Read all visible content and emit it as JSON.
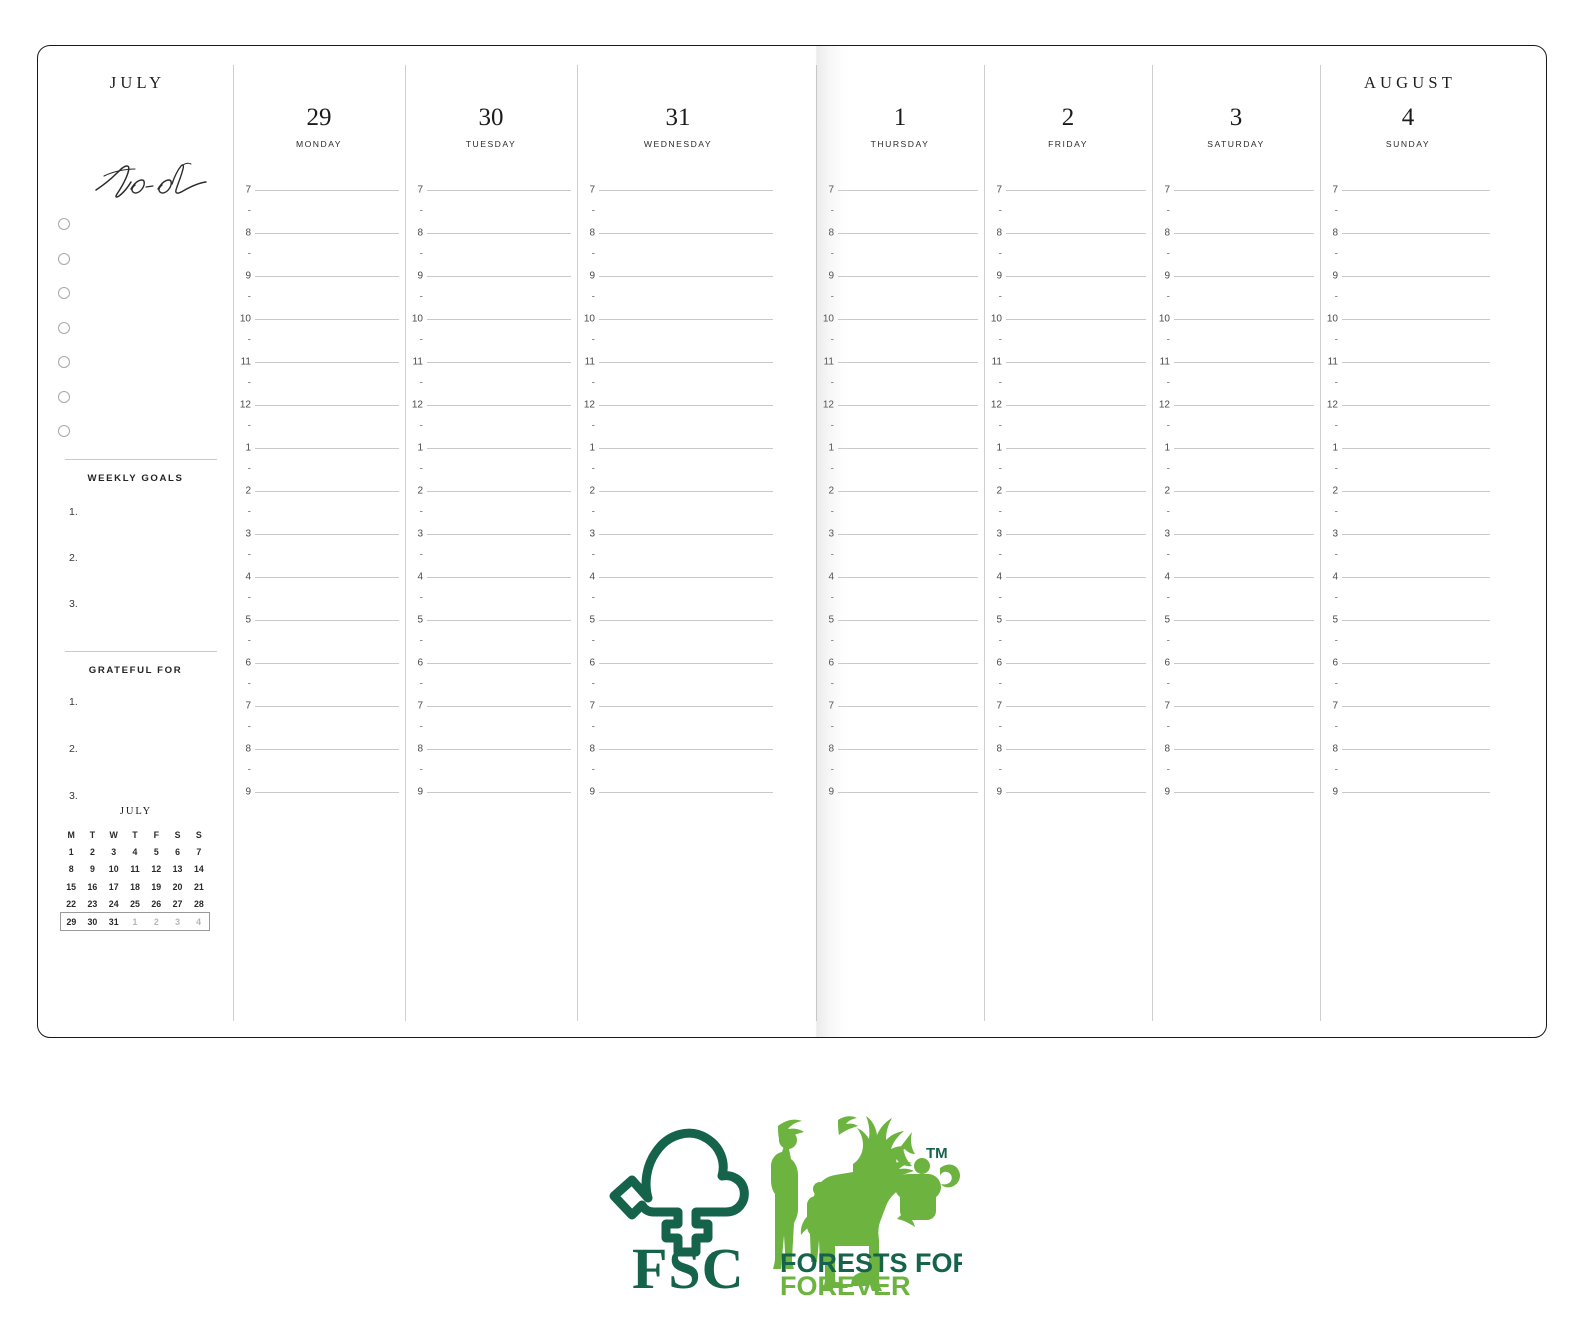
{
  "spread": {
    "left_page": {
      "month": "JULY",
      "todo": {
        "script_label": "To-do",
        "checkbox_count": 7
      },
      "weekly_goals": {
        "title": "WEEKLY GOALS",
        "items": [
          "1.",
          "2.",
          "3."
        ]
      },
      "grateful_for": {
        "title": "GRATEFUL FOR",
        "items": [
          "1.",
          "2.",
          "3."
        ]
      },
      "mini_calendar": {
        "title": "JULY",
        "weekday_headers": [
          "M",
          "T",
          "W",
          "T",
          "F",
          "S",
          "S"
        ],
        "weeks": [
          [
            {
              "d": "1",
              "dim": false
            },
            {
              "d": "2",
              "dim": false
            },
            {
              "d": "3",
              "dim": false
            },
            {
              "d": "4",
              "dim": false
            },
            {
              "d": "5",
              "dim": false
            },
            {
              "d": "6",
              "dim": false
            },
            {
              "d": "7",
              "dim": false
            }
          ],
          [
            {
              "d": "8",
              "dim": false
            },
            {
              "d": "9",
              "dim": false
            },
            {
              "d": "10",
              "dim": false
            },
            {
              "d": "11",
              "dim": false
            },
            {
              "d": "12",
              "dim": false
            },
            {
              "d": "13",
              "dim": false
            },
            {
              "d": "14",
              "dim": false
            }
          ],
          [
            {
              "d": "15",
              "dim": false
            },
            {
              "d": "16",
              "dim": false
            },
            {
              "d": "17",
              "dim": false
            },
            {
              "d": "18",
              "dim": false
            },
            {
              "d": "19",
              "dim": false
            },
            {
              "d": "20",
              "dim": false
            },
            {
              "d": "21",
              "dim": false
            }
          ],
          [
            {
              "d": "22",
              "dim": false
            },
            {
              "d": "23",
              "dim": false
            },
            {
              "d": "24",
              "dim": false
            },
            {
              "d": "25",
              "dim": false
            },
            {
              "d": "26",
              "dim": false
            },
            {
              "d": "27",
              "dim": false
            },
            {
              "d": "28",
              "dim": false
            }
          ],
          [
            {
              "d": "29",
              "dim": false
            },
            {
              "d": "30",
              "dim": false
            },
            {
              "d": "31",
              "dim": false
            },
            {
              "d": "1",
              "dim": true
            },
            {
              "d": "2",
              "dim": true
            },
            {
              "d": "3",
              "dim": true
            },
            {
              "d": "4",
              "dim": true
            }
          ]
        ],
        "highlighted_week_index": 4
      }
    },
    "right_page": {
      "month": "AUGUST"
    },
    "days": [
      {
        "num": "29",
        "name": "MONDAY",
        "page": "left"
      },
      {
        "num": "30",
        "name": "TUESDAY",
        "page": "left"
      },
      {
        "num": "31",
        "name": "WEDNESDAY",
        "page": "left"
      },
      {
        "num": "1",
        "name": "THURSDAY",
        "page": "right"
      },
      {
        "num": "2",
        "name": "FRIDAY",
        "page": "right"
      },
      {
        "num": "3",
        "name": "SATURDAY",
        "page": "right"
      },
      {
        "num": "4",
        "name": "SUNDAY",
        "page": "right"
      }
    ],
    "time_slots": [
      {
        "label": "7",
        "type": "hour"
      },
      {
        "label": "-",
        "type": "half"
      },
      {
        "label": "8",
        "type": "hour"
      },
      {
        "label": "-",
        "type": "half"
      },
      {
        "label": "9",
        "type": "hour"
      },
      {
        "label": "-",
        "type": "half"
      },
      {
        "label": "10",
        "type": "hour"
      },
      {
        "label": "-",
        "type": "half"
      },
      {
        "label": "11",
        "type": "hour"
      },
      {
        "label": "-",
        "type": "half"
      },
      {
        "label": "12",
        "type": "hour"
      },
      {
        "label": "-",
        "type": "half"
      },
      {
        "label": "1",
        "type": "hour"
      },
      {
        "label": "-",
        "type": "half"
      },
      {
        "label": "2",
        "type": "hour"
      },
      {
        "label": "-",
        "type": "half"
      },
      {
        "label": "3",
        "type": "hour"
      },
      {
        "label": "-",
        "type": "half"
      },
      {
        "label": "4",
        "type": "hour"
      },
      {
        "label": "-",
        "type": "half"
      },
      {
        "label": "5",
        "type": "hour"
      },
      {
        "label": "-",
        "type": "half"
      },
      {
        "label": "6",
        "type": "hour"
      },
      {
        "label": "-",
        "type": "half"
      },
      {
        "label": "7",
        "type": "hour"
      },
      {
        "label": "-",
        "type": "half"
      },
      {
        "label": "8",
        "type": "hour"
      },
      {
        "label": "-",
        "type": "half"
      },
      {
        "label": "9",
        "type": "hour"
      }
    ]
  },
  "fsc_logo": {
    "acronym": "FSC",
    "tagline_line1": "FORESTS FOR ALL",
    "tagline_line2": "FOREVER",
    "trademark": "TM",
    "colors": {
      "dark_green": "#15634a",
      "light_green": "#6cb33f"
    }
  }
}
